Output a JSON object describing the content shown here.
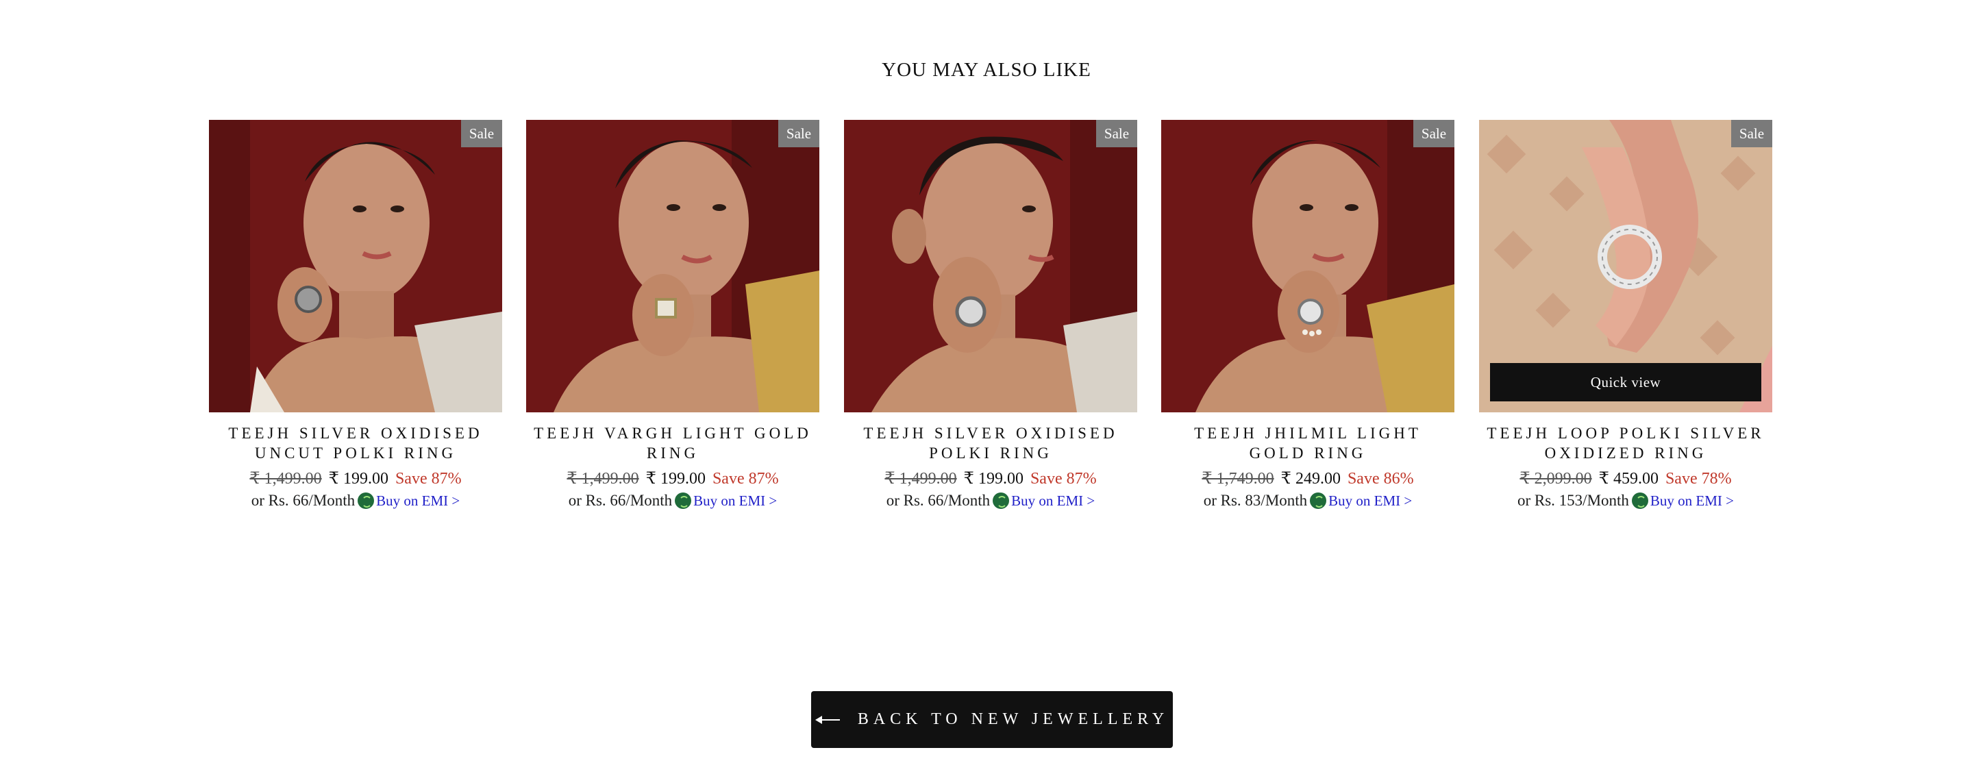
{
  "section": {
    "title": "YOU MAY ALSO LIKE"
  },
  "products": [
    {
      "title": "TEEJH SILVER OXIDISED UNCUT POLKI RING",
      "badge": "Sale",
      "price_old": "₹ 1,499.00",
      "price_now": "₹ 199.00",
      "save": "Save 87%",
      "emi_text": "or Rs. 66/Month",
      "emi_link": "Buy on EMI >",
      "image": "woman-wearing-oxidised-uncut-polki-ring"
    },
    {
      "title": "TEEJH VARGH LIGHT GOLD RING",
      "badge": "Sale",
      "price_old": "₹ 1,499.00",
      "price_now": "₹ 199.00",
      "save": "Save 87%",
      "emi_text": "or Rs. 66/Month",
      "emi_link": "Buy on EMI >",
      "image": "woman-wearing-square-light-gold-ring"
    },
    {
      "title": "TEEJH SILVER OXIDISED POLKI RING",
      "badge": "Sale",
      "price_old": "₹ 1,499.00",
      "price_now": "₹ 199.00",
      "save": "Save 87%",
      "emi_text": "or Rs. 66/Month",
      "emi_link": "Buy on EMI >",
      "image": "woman-profile-wearing-polki-ring"
    },
    {
      "title": "TEEJH JHILMIL LIGHT GOLD RING",
      "badge": "Sale",
      "price_old": "₹ 1,749.00",
      "price_now": "₹ 249.00",
      "save": "Save 86%",
      "emi_text": "or Rs. 83/Month",
      "emi_link": "Buy on EMI >",
      "image": "woman-wearing-jhilmil-ring"
    },
    {
      "title": "TEEJH LOOP POLKI SILVER OXIDIZED RING",
      "badge": "Sale",
      "price_old": "₹ 2,099.00",
      "price_now": "₹ 459.00",
      "save": "Save 78%",
      "emi_text": "or Rs. 153/Month",
      "emi_link": "Buy on EMI >",
      "quick_view": "Quick view",
      "image": "hand-wearing-loop-polki-ring"
    }
  ],
  "back_button": {
    "label": "BACK TO NEW JEWELLERY",
    "icon": "arrow-left-icon"
  },
  "colors": {
    "sale_badge": "#7a7a7a",
    "save_text": "#c0392b",
    "emi_link": "#2020c8",
    "button_bg": "#111111"
  }
}
